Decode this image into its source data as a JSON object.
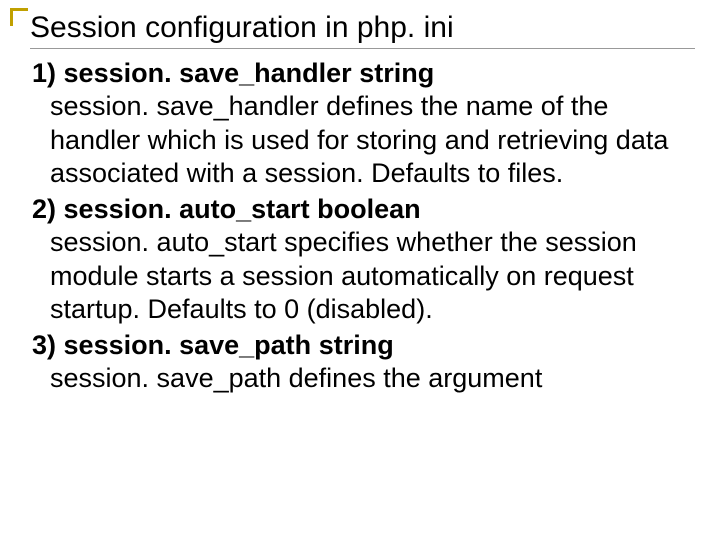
{
  "slide": {
    "title": "Session configuration in php. ini",
    "items": [
      {
        "num": "1)",
        "name": "session. save_handler",
        "leading_space": " ",
        "type": "string",
        "desc": " session. save_handler defines the name of the handler which is used for storing and retrieving data associated with a session. Defaults to files."
      },
      {
        "num": "2)",
        "name": "session. auto_start",
        "leading_space": "  ",
        "type": "boolean",
        "desc": " session. auto_start specifies whether the session module starts a session automatically on request startup. Defaults to 0 (disabled)."
      },
      {
        "num": "3)",
        "name": "session. save_path",
        "leading_space": " ",
        "type": "string",
        "desc": " session. save_path defines the argument"
      }
    ]
  }
}
